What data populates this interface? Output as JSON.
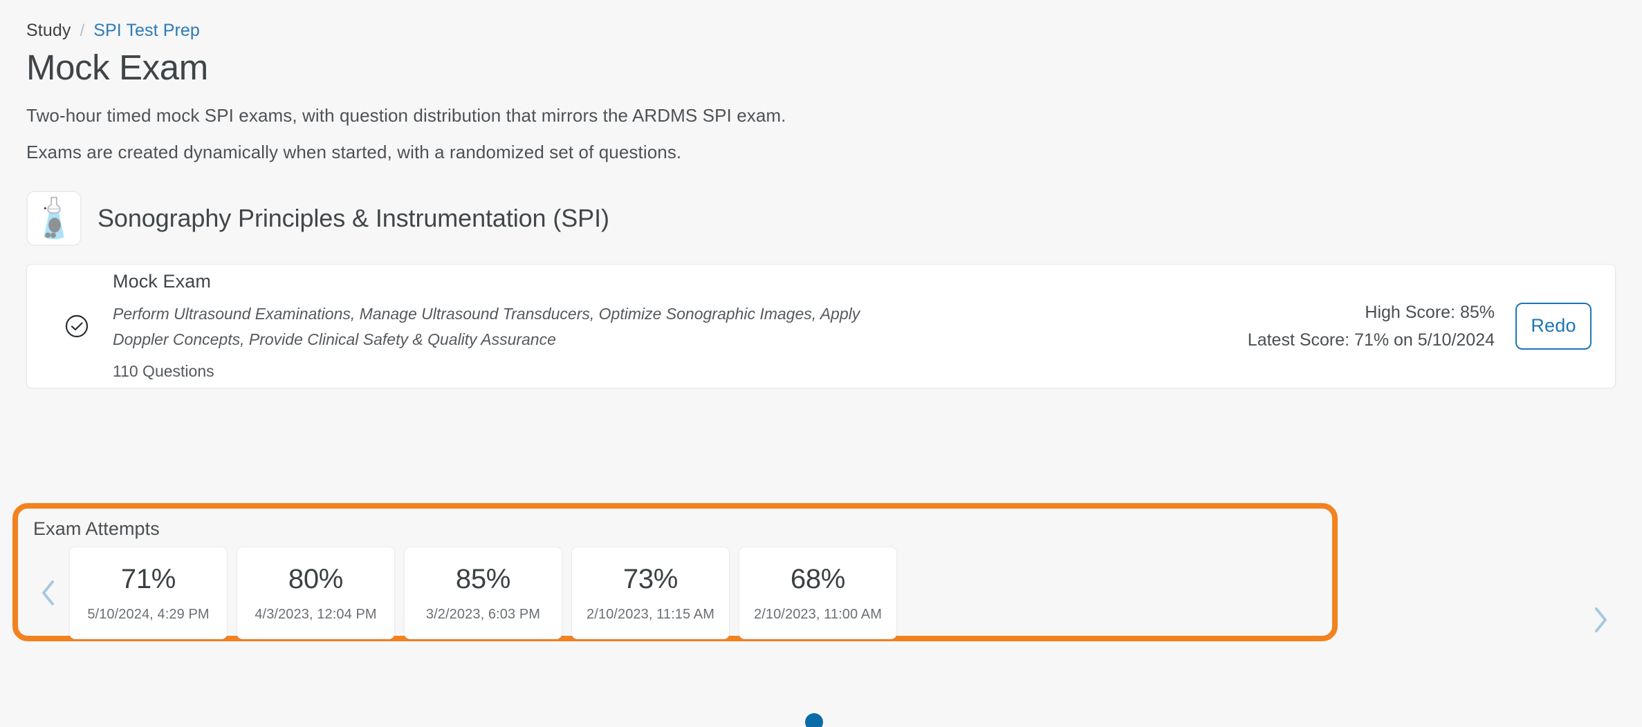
{
  "breadcrumb": {
    "parent": "Study",
    "separator": "/",
    "current": "SPI Test Prep"
  },
  "page": {
    "title": "Mock Exam",
    "description_line1": "Two-hour timed mock SPI exams, with question distribution that mirrors the ARDMS SPI exam.",
    "description_line2": "Exams are created dynamically when started, with a randomized set of questions."
  },
  "course": {
    "name": "Sonography Principles & Instrumentation (SPI)",
    "icon": "ultrasound-transducer-icon"
  },
  "exam_card": {
    "status_icon": "check-circle-icon",
    "title": "Mock Exam",
    "objectives": "Perform Ultrasound Examinations, Manage Ultrasound Transducers, Optimize Sonographic Images, Apply Doppler Concepts, Provide Clinical Safety & Quality Assurance",
    "question_count": "110 Questions",
    "high_score": "High Score: 85%",
    "latest_score": "Latest Score: 71% on 5/10/2024",
    "redo_label": "Redo"
  },
  "attempts": {
    "title": "Exam Attempts",
    "prev_icon": "chevron-left-icon",
    "next_icon": "chevron-right-icon",
    "items": [
      {
        "score": "71%",
        "date": "5/10/2024, 4:29 PM"
      },
      {
        "score": "80%",
        "date": "4/3/2023, 12:04 PM"
      },
      {
        "score": "85%",
        "date": "3/2/2023, 6:03 PM"
      },
      {
        "score": "73%",
        "date": "2/10/2023, 11:15 AM"
      },
      {
        "score": "68%",
        "date": "2/10/2023, 11:00 AM"
      }
    ],
    "pagination_dots": 1
  },
  "colors": {
    "highlight_border": "#f2821f",
    "link": "#2b7bb9",
    "accent_button": "#1b76b5",
    "pager_dot": "#0a6ba8",
    "chevron": "#a8c9de"
  }
}
